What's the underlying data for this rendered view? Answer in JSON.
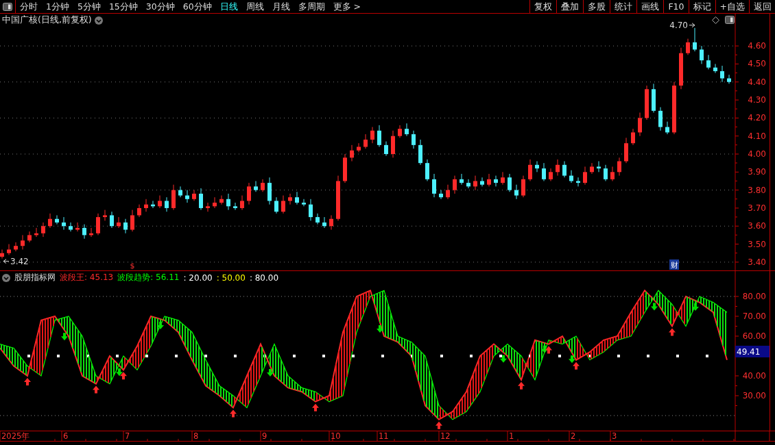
{
  "toolbar": {
    "periods": [
      {
        "label": "分时",
        "selected": false
      },
      {
        "label": "1分钟",
        "selected": false
      },
      {
        "label": "5分钟",
        "selected": false
      },
      {
        "label": "15分钟",
        "selected": false
      },
      {
        "label": "30分钟",
        "selected": false
      },
      {
        "label": "60分钟",
        "selected": false
      },
      {
        "label": "日线",
        "selected": true
      },
      {
        "label": "周线",
        "selected": false
      },
      {
        "label": "月线",
        "selected": false
      },
      {
        "label": "多周期",
        "selected": false
      },
      {
        "label": "更多 >",
        "selected": false
      }
    ],
    "buttons": [
      "复权",
      "叠加",
      "多股",
      "统计",
      "画线",
      "F10",
      "标记",
      "+自选",
      "返回"
    ]
  },
  "price_panel": {
    "title": "中国广核(日线,前复权)",
    "chart_data": {
      "type": "candlestick",
      "grid": true,
      "ylim": [
        3.354,
        4.779
      ],
      "yticks": [
        {
          "value": 3.4,
          "label": "3.40"
        },
        {
          "value": 3.5,
          "label": "3.50"
        },
        {
          "value": 3.6,
          "label": "3.60"
        },
        {
          "value": 3.7,
          "label": "3.70"
        },
        {
          "value": 3.8,
          "label": "3.80"
        },
        {
          "value": 3.9,
          "label": "3.90"
        },
        {
          "value": 4.0,
          "label": "4.00"
        },
        {
          "value": 4.1,
          "label": "4.10"
        },
        {
          "value": 4.2,
          "label": "4.20"
        },
        {
          "value": 4.3,
          "label": "4.30"
        },
        {
          "value": 4.4,
          "label": "4.40"
        },
        {
          "value": 4.5,
          "label": "4.50"
        },
        {
          "value": 4.6,
          "label": "4.60"
        }
      ],
      "ohlc": [
        [
          3.43,
          3.47,
          3.42,
          3.45
        ],
        [
          3.45,
          3.5,
          3.44,
          3.47
        ],
        [
          3.47,
          3.51,
          3.46,
          3.49
        ],
        [
          3.49,
          3.55,
          3.47,
          3.52
        ],
        [
          3.52,
          3.57,
          3.51,
          3.55
        ],
        [
          3.55,
          3.59,
          3.54,
          3.56
        ],
        [
          3.56,
          3.62,
          3.54,
          3.6
        ],
        [
          3.6,
          3.67,
          3.59,
          3.64
        ],
        [
          3.64,
          3.66,
          3.61,
          3.62
        ],
        [
          3.62,
          3.65,
          3.58,
          3.6
        ],
        [
          3.6,
          3.62,
          3.57,
          3.58
        ],
        [
          3.58,
          3.62,
          3.57,
          3.59
        ],
        [
          3.59,
          3.61,
          3.53,
          3.55
        ],
        [
          3.55,
          3.59,
          3.54,
          3.56
        ],
        [
          3.56,
          3.67,
          3.55,
          3.65
        ],
        [
          3.65,
          3.69,
          3.63,
          3.66
        ],
        [
          3.66,
          3.68,
          3.59,
          3.6
        ],
        [
          3.6,
          3.65,
          3.59,
          3.62
        ],
        [
          3.62,
          3.64,
          3.56,
          3.58
        ],
        [
          3.58,
          3.69,
          3.57,
          3.66
        ],
        [
          3.66,
          3.72,
          3.65,
          3.7
        ],
        [
          3.7,
          3.75,
          3.68,
          3.72
        ],
        [
          3.72,
          3.74,
          3.7,
          3.71
        ],
        [
          3.71,
          3.77,
          3.7,
          3.74
        ],
        [
          3.74,
          3.76,
          3.68,
          3.7
        ],
        [
          3.7,
          3.83,
          3.69,
          3.8
        ],
        [
          3.8,
          3.82,
          3.76,
          3.77
        ],
        [
          3.77,
          3.8,
          3.73,
          3.75
        ],
        [
          3.75,
          3.8,
          3.74,
          3.78
        ],
        [
          3.78,
          3.81,
          3.69,
          3.7
        ],
        [
          3.7,
          3.73,
          3.68,
          3.71
        ],
        [
          3.71,
          3.76,
          3.7,
          3.73
        ],
        [
          3.73,
          3.77,
          3.72,
          3.75
        ],
        [
          3.75,
          3.78,
          3.69,
          3.71
        ],
        [
          3.71,
          3.73,
          3.69,
          3.7
        ],
        [
          3.7,
          3.77,
          3.69,
          3.74
        ],
        [
          3.74,
          3.84,
          3.72,
          3.82
        ],
        [
          3.82,
          3.85,
          3.79,
          3.8
        ],
        [
          3.8,
          3.86,
          3.79,
          3.84
        ],
        [
          3.84,
          3.87,
          3.72,
          3.74
        ],
        [
          3.74,
          3.76,
          3.67,
          3.68
        ],
        [
          3.68,
          3.77,
          3.67,
          3.74
        ],
        [
          3.74,
          3.78,
          3.72,
          3.76
        ],
        [
          3.76,
          3.79,
          3.72,
          3.73
        ],
        [
          3.73,
          3.75,
          3.71,
          3.72
        ],
        [
          3.72,
          3.75,
          3.63,
          3.65
        ],
        [
          3.65,
          3.67,
          3.61,
          3.62
        ],
        [
          3.62,
          3.65,
          3.59,
          3.6
        ],
        [
          3.6,
          3.66,
          3.58,
          3.64
        ],
        [
          3.64,
          3.88,
          3.63,
          3.85
        ],
        [
          3.85,
          4.0,
          3.84,
          3.98
        ],
        [
          3.98,
          4.05,
          3.96,
          4.02
        ],
        [
          4.02,
          4.06,
          4.01,
          4.04
        ],
        [
          4.04,
          4.11,
          4.03,
          4.08
        ],
        [
          4.08,
          4.15,
          4.06,
          4.13
        ],
        [
          4.13,
          4.16,
          4.04,
          4.05
        ],
        [
          4.05,
          4.07,
          3.99,
          4.0
        ],
        [
          4.0,
          4.13,
          3.98,
          4.1
        ],
        [
          4.1,
          4.16,
          4.09,
          4.14
        ],
        [
          4.14,
          4.17,
          4.1,
          4.11
        ],
        [
          4.11,
          4.13,
          4.03,
          4.05
        ],
        [
          4.05,
          4.08,
          3.94,
          3.95
        ],
        [
          3.95,
          3.97,
          3.85,
          3.86
        ],
        [
          3.86,
          3.89,
          3.76,
          3.78
        ],
        [
          3.78,
          3.8,
          3.75,
          3.76
        ],
        [
          3.76,
          3.83,
          3.75,
          3.8
        ],
        [
          3.8,
          3.88,
          3.78,
          3.86
        ],
        [
          3.86,
          3.89,
          3.83,
          3.84
        ],
        [
          3.84,
          3.86,
          3.81,
          3.82
        ],
        [
          3.82,
          3.88,
          3.8,
          3.85
        ],
        [
          3.85,
          3.87,
          3.82,
          3.83
        ],
        [
          3.83,
          3.89,
          3.82,
          3.86
        ],
        [
          3.86,
          3.88,
          3.82,
          3.84
        ],
        [
          3.84,
          3.9,
          3.83,
          3.87
        ],
        [
          3.87,
          3.89,
          3.79,
          3.8
        ],
        [
          3.8,
          3.83,
          3.75,
          3.77
        ],
        [
          3.77,
          3.88,
          3.76,
          3.86
        ],
        [
          3.86,
          3.97,
          3.85,
          3.94
        ],
        [
          3.94,
          3.96,
          3.9,
          3.92
        ],
        [
          3.92,
          3.95,
          3.85,
          3.86
        ],
        [
          3.86,
          3.92,
          3.85,
          3.9
        ],
        [
          3.9,
          3.97,
          3.88,
          3.94
        ],
        [
          3.94,
          3.96,
          3.87,
          3.88
        ],
        [
          3.88,
          3.91,
          3.84,
          3.85
        ],
        [
          3.85,
          3.87,
          3.82,
          3.84
        ],
        [
          3.84,
          3.93,
          3.83,
          3.9
        ],
        [
          3.9,
          3.95,
          3.89,
          3.93
        ],
        [
          3.93,
          3.96,
          3.9,
          3.92
        ],
        [
          3.92,
          3.94,
          3.85,
          3.86
        ],
        [
          3.86,
          3.93,
          3.85,
          3.9
        ],
        [
          3.9,
          3.98,
          3.88,
          3.96
        ],
        [
          3.96,
          4.09,
          3.95,
          4.06
        ],
        [
          4.06,
          4.14,
          4.05,
          4.12
        ],
        [
          4.12,
          4.23,
          4.1,
          4.2
        ],
        [
          4.2,
          4.38,
          4.19,
          4.36
        ],
        [
          4.36,
          4.39,
          4.23,
          4.24
        ],
        [
          4.24,
          4.26,
          4.13,
          4.15
        ],
        [
          4.15,
          4.18,
          4.11,
          4.12
        ],
        [
          4.12,
          4.4,
          4.11,
          4.38
        ],
        [
          4.38,
          4.59,
          4.36,
          4.56
        ],
        [
          4.56,
          4.64,
          4.55,
          4.62
        ],
        [
          4.62,
          4.7,
          4.57,
          4.58
        ],
        [
          4.58,
          4.6,
          4.5,
          4.52
        ],
        [
          4.52,
          4.55,
          4.47,
          4.48
        ],
        [
          4.48,
          4.5,
          4.45,
          4.46
        ],
        [
          4.46,
          4.49,
          4.4,
          4.42
        ],
        [
          4.42,
          4.44,
          4.39,
          4.4
        ]
      ],
      "annotations": [
        "4.70",
        "3.42"
      ]
    },
    "markers": [
      {
        "kind": "dividend",
        "text": "$"
      },
      {
        "kind": "report",
        "text": "财"
      }
    ],
    "time_axis": [
      "2025年",
      "6",
      "7",
      "8",
      "9",
      "10",
      "11",
      "12",
      "1",
      "2",
      "3"
    ]
  },
  "indicator_panel": {
    "name": "股朋指标网",
    "legend": [
      {
        "value": "45.13"
      },
      {
        "value": "56.11"
      },
      {
        "label": ":",
        "value": "20.00",
        "color": "#ffffff"
      },
      {
        "label": ":",
        "value": "50.00",
        "color": "#ffff00"
      },
      {
        "label": ":",
        "value": "80.00",
        "color": "#ffffff"
      }
    ],
    "cursor_value": "49.41",
    "chart_data": {
      "type": "line",
      "ylim": [
        12.41,
        92.76
      ],
      "yticks": [
        {
          "value": 30,
          "label": "30.00"
        },
        {
          "value": 40,
          "label": "40.00"
        },
        {
          "value": 60,
          "label": "60.00"
        },
        {
          "value": 70,
          "label": "70.00"
        },
        {
          "value": 80,
          "label": "80.00"
        }
      ],
      "series": [
        {
          "name": "波段王:",
          "color": "#ff2a2a",
          "values": [
            54,
            45,
            40,
            68,
            70,
            60,
            40,
            36,
            50,
            43,
            55,
            70,
            68,
            62,
            48,
            35,
            30,
            24,
            40,
            56,
            40,
            34,
            32,
            27,
            30,
            62,
            80,
            83,
            60,
            57,
            50,
            25,
            18,
            22,
            32,
            50,
            56,
            50,
            38,
            58,
            56,
            60,
            48,
            52,
            58,
            60,
            72,
            83,
            76,
            65,
            80,
            77,
            72,
            48
          ]
        },
        {
          "name": "波段趋势:",
          "color": "#00ff00",
          "values": [
            56,
            54,
            45,
            40,
            68,
            70,
            60,
            40,
            36,
            50,
            43,
            55,
            70,
            68,
            62,
            48,
            35,
            30,
            24,
            40,
            56,
            40,
            34,
            32,
            27,
            30,
            62,
            80,
            83,
            60,
            57,
            50,
            25,
            18,
            22,
            32,
            50,
            56,
            50,
            38,
            58,
            56,
            60,
            48,
            52,
            58,
            60,
            72,
            83,
            76,
            65,
            80,
            77,
            72
          ]
        }
      ]
    }
  }
}
